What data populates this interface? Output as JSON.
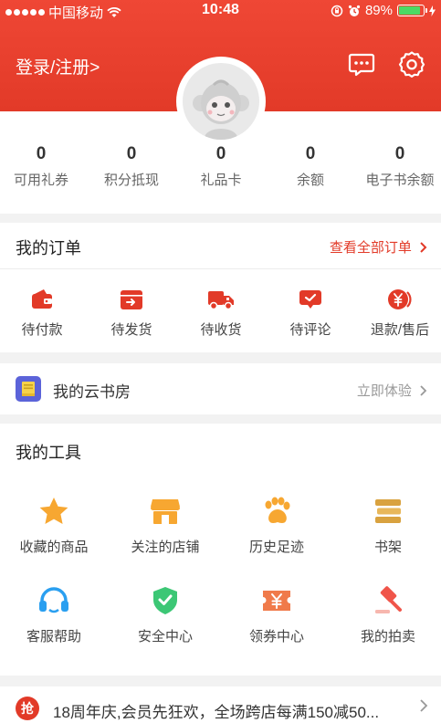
{
  "status_bar": {
    "carrier": "中国移动",
    "time": "10:48",
    "battery": "89%"
  },
  "header": {
    "login_label": "登录/注册>"
  },
  "stats": [
    {
      "value": "0",
      "label": "可用礼券"
    },
    {
      "value": "0",
      "label": "积分抵现"
    },
    {
      "value": "0",
      "label": "礼品卡"
    },
    {
      "value": "0",
      "label": "余额"
    },
    {
      "value": "0",
      "label": "电子书余额"
    }
  ],
  "orders": {
    "title": "我的订单",
    "view_all": "查看全部订单",
    "items": [
      {
        "label": "待付款",
        "icon": "wallet-icon"
      },
      {
        "label": "待发货",
        "icon": "box-icon"
      },
      {
        "label": "待收货",
        "icon": "truck-icon"
      },
      {
        "label": "待评论",
        "icon": "comment-icon"
      },
      {
        "label": "退款/售后",
        "icon": "refund-icon"
      }
    ]
  },
  "cloud_bookroom": {
    "label": "我的云书房",
    "cta": "立即体验"
  },
  "tools": {
    "title": "我的工具",
    "items": [
      {
        "label": "收藏的商品",
        "icon": "star-icon"
      },
      {
        "label": "关注的店铺",
        "icon": "store-icon"
      },
      {
        "label": "历史足迹",
        "icon": "paw-icon"
      },
      {
        "label": "书架",
        "icon": "bookshelf-icon"
      },
      {
        "label": "客服帮助",
        "icon": "headset-icon"
      },
      {
        "label": "安全中心",
        "icon": "shield-icon"
      },
      {
        "label": "领券中心",
        "icon": "coupon-icon"
      },
      {
        "label": "我的拍卖",
        "icon": "gavel-icon"
      }
    ]
  },
  "promo": {
    "badge": "抢",
    "text": "18周年庆,会员先狂欢，全场跨店每满150减50..."
  },
  "colors": {
    "brand_red": "#e23a28",
    "tool_orange": "#f7a731",
    "tool_blue": "#2a9ff0",
    "tool_green": "#3cc775",
    "cloud_purple": "#5b63d9"
  }
}
